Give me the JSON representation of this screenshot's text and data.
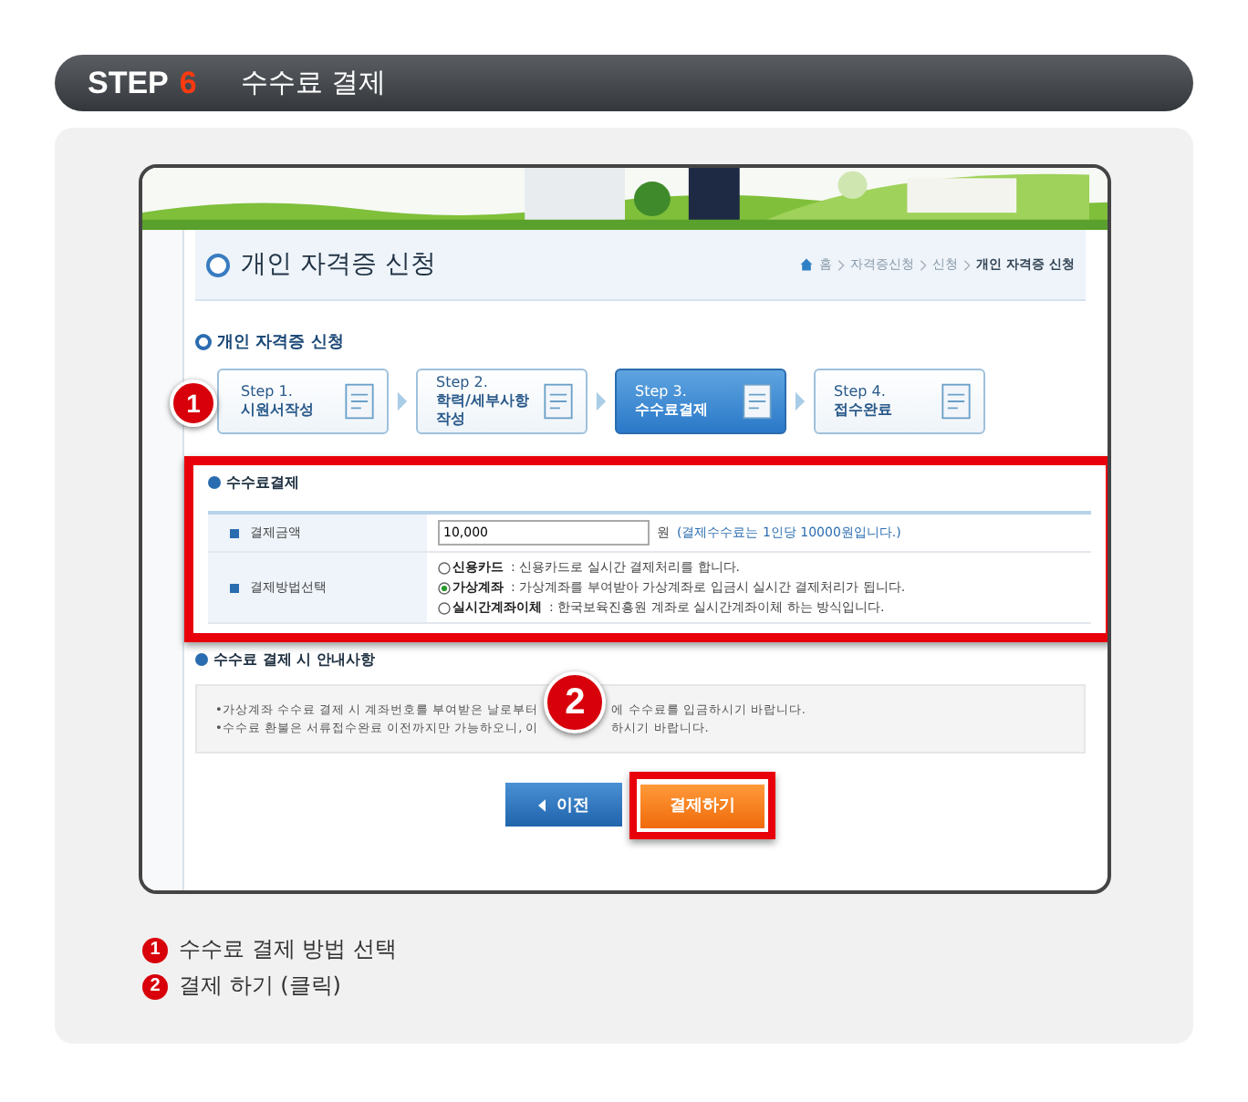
{
  "header": {
    "step_label": "STEP",
    "step_number": "6",
    "title": "수수료 결제"
  },
  "screen": {
    "banner": {
      "kind": "picture"
    },
    "page_title": "개인 자격증 신청",
    "breadcrumb": [
      "홈",
      "자격증신청",
      "신청",
      "개인 자격증 신청"
    ],
    "section_title": "개인 자격증 신청",
    "steps": [
      {
        "step": "Step 1.",
        "label": "시원서작성",
        "selected": false
      },
      {
        "step": "Step 2.",
        "label": "학력/세부사항 작성",
        "selected": false
      },
      {
        "step": "Step 3.",
        "label": "수수료결제",
        "selected": true
      },
      {
        "step": "Step 4.",
        "label": "접수완료",
        "selected": false
      }
    ],
    "payment": {
      "title": "수수료결제",
      "amount_label": "결제금액",
      "amount_value": "10,000",
      "amount_unit": "원",
      "amount_note": "(결제수수료는 1인당 10000원입니다.)",
      "method_label": "결제방법선택",
      "methods": [
        {
          "name": "신용카드",
          "description": ": 신용카드로 실시간 결제처리를 합니다.",
          "selected": false
        },
        {
          "name": "가상계좌",
          "description": ": 가상계좌를 부여받아 가상계좌로 입금시 실시간 결제처리가 됩니다.",
          "selected": true
        },
        {
          "name": "실시간계좌이체",
          "description": ": 한국보육진흥원 계좌로 실시간계좌이체 하는 방식입니다.",
          "selected": false
        }
      ]
    },
    "notice": {
      "title": "수수료 결제 시 안내사항",
      "lines": [
        [
          "•가상계좌 수수료 결제 시 계좌번호를 부여받은 날로부터",
          "에 수수료를 입금하시기 바랍니다."
        ],
        [
          "•수수료 환불은 서류접수완료 이전까지만 가능하오니, 이",
          "하시기 바랍니다."
        ]
      ]
    },
    "buttons": {
      "prev": "이전",
      "pay": "결제하기"
    },
    "badges": [
      "1",
      "2"
    ]
  },
  "callouts": [
    {
      "number": "1",
      "text": "수수료 결제 방법 선택"
    },
    {
      "number": "2",
      "text": "결제 하기 (클릭)"
    }
  ]
}
